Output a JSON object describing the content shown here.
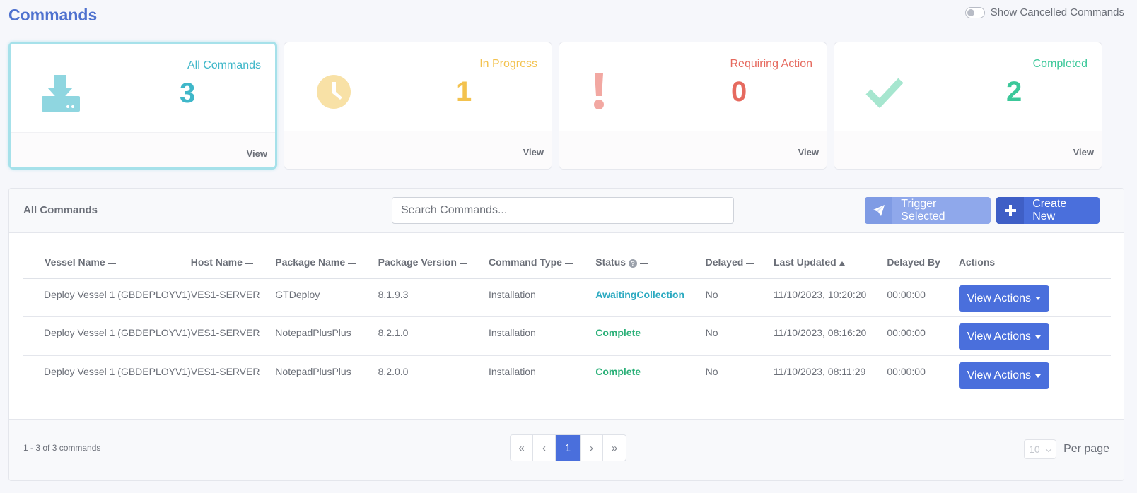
{
  "page": {
    "title": "Commands"
  },
  "toggle": {
    "label": "Show Cancelled Commands"
  },
  "colors": {
    "accent": "#4a6fdc",
    "all": "#3fb7c9",
    "progress": "#f3c24e",
    "action": "#e66a5f",
    "completed": "#3cc89a"
  },
  "cards": [
    {
      "label": "All Commands",
      "count": "3",
      "view": "View",
      "icon": "download-tray-icon"
    },
    {
      "label": "In Progress",
      "count": "1",
      "view": "View",
      "icon": "clock-icon"
    },
    {
      "label": "Requiring Action",
      "count": "0",
      "view": "View",
      "icon": "exclamation-icon"
    },
    {
      "label": "Completed",
      "count": "2",
      "view": "View",
      "icon": "check-icon"
    }
  ],
  "panel": {
    "title": "All Commands",
    "search_placeholder": "Search Commands...",
    "trigger_label": "Trigger Selected",
    "create_label": "Create New"
  },
  "table": {
    "headers": [
      "Vessel Name",
      "Host Name",
      "Package Name",
      "Package Version",
      "Command Type",
      "Status",
      "Delayed",
      "Last Updated",
      "Delayed By",
      "Actions"
    ],
    "rows": [
      {
        "vessel": "Deploy Vessel 1 (GBDEPLOYV1)",
        "host": "VES1-SERVER",
        "package": "GTDeploy",
        "version": "8.1.9.3",
        "type": "Installation",
        "status": "AwaitingCollection",
        "delayed": "No",
        "updated": "11/10/2023, 10:20:20",
        "delayed_by": "00:00:00",
        "action": "View Actions"
      },
      {
        "vessel": "Deploy Vessel 1 (GBDEPLOYV1)",
        "host": "VES1-SERVER",
        "package": "NotepadPlusPlus",
        "version": "8.2.1.0",
        "type": "Installation",
        "status": "Complete",
        "delayed": "No",
        "updated": "11/10/2023, 08:16:20",
        "delayed_by": "00:00:00",
        "action": "View Actions"
      },
      {
        "vessel": "Deploy Vessel 1 (GBDEPLOYV1)",
        "host": "VES1-SERVER",
        "package": "NotepadPlusPlus",
        "version": "8.2.0.0",
        "type": "Installation",
        "status": "Complete",
        "delayed": "No",
        "updated": "11/10/2023, 08:11:29",
        "delayed_by": "00:00:00",
        "action": "View Actions"
      }
    ]
  },
  "footer": {
    "count_text": "1 - 3 of 3 commands",
    "pagination": {
      "first": "«",
      "prev": "‹",
      "current": "1",
      "next": "›",
      "last": "»"
    },
    "per_page_value": "10",
    "per_page_label": "Per page"
  }
}
